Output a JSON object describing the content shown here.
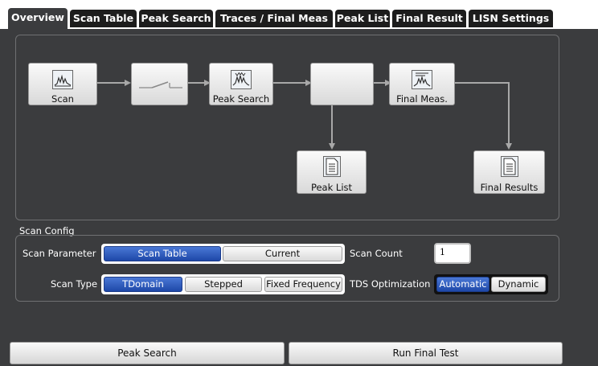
{
  "tabs": [
    {
      "label": "Overview",
      "active": true
    },
    {
      "label": "Scan Table",
      "active": false
    },
    {
      "label": "Peak Search",
      "active": false
    },
    {
      "label": "Traces / Final Meas",
      "active": false
    },
    {
      "label": "Peak List",
      "active": false
    },
    {
      "label": "Final Result",
      "active": false
    },
    {
      "label": "LISN Settings",
      "active": false
    }
  ],
  "flow": {
    "scan": "Scan",
    "peak_search": "Peak Search",
    "final_meas": "Final Meas.",
    "peak_list": "Peak List",
    "final_results": "Final Results"
  },
  "scan_config": {
    "title": "Scan Config",
    "scan_parameter": {
      "label": "Scan Parameter",
      "options": [
        "Scan Table",
        "Current"
      ],
      "selected": "Scan Table"
    },
    "scan_count": {
      "label": "Scan Count",
      "value": "1"
    },
    "scan_type": {
      "label": "Scan Type",
      "options": [
        "TDomain",
        "Stepped",
        "Fixed Frequency"
      ],
      "selected": "TDomain"
    },
    "tds_optimization": {
      "label": "TDS Optimization",
      "options": [
        "Automatic",
        "Dynamic"
      ],
      "selected": "Automatic"
    }
  },
  "buttons": {
    "peak_search": "Peak Search",
    "run_final_test": "Run Final Test"
  },
  "colors": {
    "background": "#3b3c3e",
    "tab_inactive": "#1d1d1d",
    "selected": "#1e48a8"
  }
}
